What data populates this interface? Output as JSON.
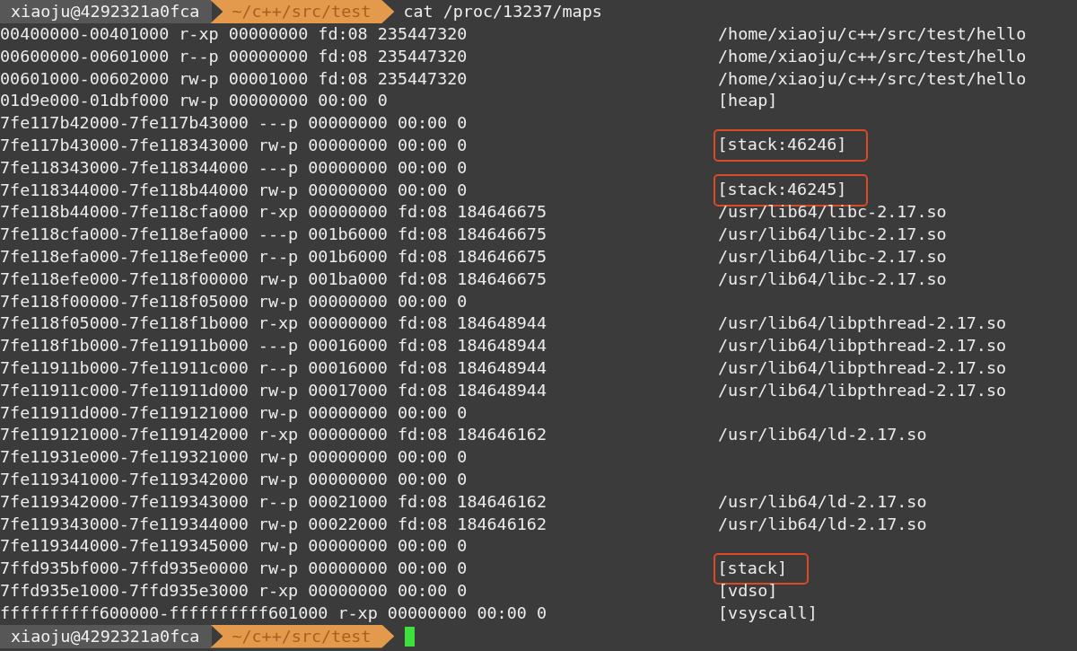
{
  "prompts": [
    {
      "user": "xiaoju@4292321a0fca",
      "path": "~/c++/src/test",
      "command": "cat /proc/13237/maps"
    },
    {
      "user": "xiaoju@4292321a0fca",
      "path": "~/c++/src/test",
      "cursor": true
    }
  ],
  "rows": [
    {
      "mapping": "00400000-00401000 r-xp 00000000 fd:08 235447320",
      "path": "/home/xiaoju/c++/src/test/hello",
      "highlighted": false
    },
    {
      "mapping": "00600000-00601000 r--p 00000000 fd:08 235447320",
      "path": "/home/xiaoju/c++/src/test/hello",
      "highlighted": false
    },
    {
      "mapping": "00601000-00602000 rw-p 00001000 fd:08 235447320",
      "path": "/home/xiaoju/c++/src/test/hello",
      "highlighted": false
    },
    {
      "mapping": "01d9e000-01dbf000 rw-p 00000000 00:00 0",
      "path": "[heap]",
      "highlighted": false
    },
    {
      "mapping": "7fe117b42000-7fe117b43000 ---p 00000000 00:00 0"
    },
    {
      "mapping": "7fe117b43000-7fe118343000 rw-p 00000000 00:00 0",
      "path": "[stack:46246]",
      "highlighted": true
    },
    {
      "mapping": "7fe118343000-7fe118344000 ---p 00000000 00:00 0"
    },
    {
      "mapping": "7fe118344000-7fe118b44000 rw-p 00000000 00:00 0",
      "path": "[stack:46245]",
      "highlighted": true
    },
    {
      "mapping": "7fe118b44000-7fe118cfa000 r-xp 00000000 fd:08 184646675",
      "path": "/usr/lib64/libc-2.17.so",
      "highlighted": false
    },
    {
      "mapping": "7fe118cfa000-7fe118efa000 ---p 001b6000 fd:08 184646675",
      "path": "/usr/lib64/libc-2.17.so",
      "highlighted": false
    },
    {
      "mapping": "7fe118efa000-7fe118efe000 r--p 001b6000 fd:08 184646675",
      "path": "/usr/lib64/libc-2.17.so",
      "highlighted": false
    },
    {
      "mapping": "7fe118efe000-7fe118f00000 rw-p 001ba000 fd:08 184646675",
      "path": "/usr/lib64/libc-2.17.so",
      "highlighted": false
    },
    {
      "mapping": "7fe118f00000-7fe118f05000 rw-p 00000000 00:00 0"
    },
    {
      "mapping": "7fe118f05000-7fe118f1b000 r-xp 00000000 fd:08 184648944",
      "path": "/usr/lib64/libpthread-2.17.so",
      "highlighted": false
    },
    {
      "mapping": "7fe118f1b000-7fe11911b000 ---p 00016000 fd:08 184648944",
      "path": "/usr/lib64/libpthread-2.17.so",
      "highlighted": false
    },
    {
      "mapping": "7fe11911b000-7fe11911c000 r--p 00016000 fd:08 184648944",
      "path": "/usr/lib64/libpthread-2.17.so",
      "highlighted": false
    },
    {
      "mapping": "7fe11911c000-7fe11911d000 rw-p 00017000 fd:08 184648944",
      "path": "/usr/lib64/libpthread-2.17.so",
      "highlighted": false
    },
    {
      "mapping": "7fe11911d000-7fe119121000 rw-p 00000000 00:00 0"
    },
    {
      "mapping": "7fe119121000-7fe119142000 r-xp 00000000 fd:08 184646162",
      "path": "/usr/lib64/ld-2.17.so",
      "highlighted": false
    },
    {
      "mapping": "7fe11931e000-7fe119321000 rw-p 00000000 00:00 0"
    },
    {
      "mapping": "7fe119341000-7fe119342000 rw-p 00000000 00:00 0"
    },
    {
      "mapping": "7fe119342000-7fe119343000 r--p 00021000 fd:08 184646162",
      "path": "/usr/lib64/ld-2.17.so",
      "highlighted": false
    },
    {
      "mapping": "7fe119343000-7fe119344000 rw-p 00022000 fd:08 184646162",
      "path": "/usr/lib64/ld-2.17.so",
      "highlighted": false
    },
    {
      "mapping": "7fe119344000-7fe119345000 rw-p 00000000 00:00 0"
    },
    {
      "mapping": "7ffd935bf000-7ffd935e0000 rw-p 00000000 00:00 0",
      "path": "[stack]",
      "highlighted": true
    },
    {
      "mapping": "7ffd935e1000-7ffd935e3000 r-xp 00000000 00:00 0",
      "path": "[vdso]",
      "highlighted": false
    },
    {
      "mapping": "ffffffffff600000-ffffffffff601000 r-xp 00000000 00:00 0",
      "path": "[vsyscall]",
      "highlighted": false
    }
  ]
}
